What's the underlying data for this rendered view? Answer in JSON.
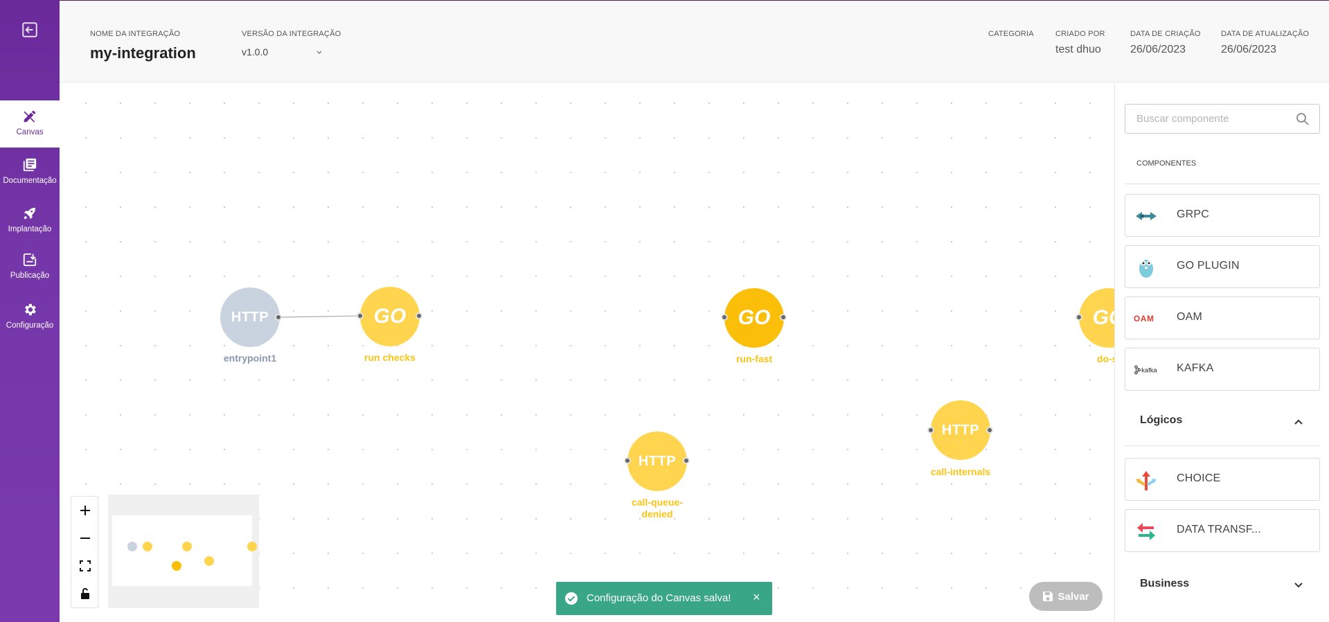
{
  "sidebar": {
    "items": [
      {
        "label": "Canvas",
        "icon": "pencil-ruler-icon"
      },
      {
        "label": "Documentação",
        "icon": "book-icon"
      },
      {
        "label": "Implantação",
        "icon": "rocket-icon"
      },
      {
        "label": "Publicação",
        "icon": "download-icon"
      },
      {
        "label": "Configuração",
        "icon": "gear-icon"
      }
    ]
  },
  "header": {
    "name_label": "NOME DA INTEGRAÇÃO",
    "name_value": "my-integration",
    "version_label": "VERSÃO DA INTEGRAÇÃO",
    "version_value": "v1.0.0",
    "category_label": "CATEGORIA",
    "created_by_label": "CRIADO POR",
    "created_by_value": "test dhuo",
    "created_date_label": "DATA DE CRIAÇÃO",
    "created_date_value": "26/06/2023",
    "updated_date_label": "DATA DE ATUALIZAÇÃO",
    "updated_date_value": "26/06/2023"
  },
  "canvas": {
    "nodes": [
      {
        "id": "entrypoint1",
        "label": "entrypoint1",
        "text": "HTTP",
        "kind": "http-entry"
      },
      {
        "id": "run-checks",
        "label": "run checks",
        "text": "GO",
        "kind": "go"
      },
      {
        "id": "run-fast",
        "label": "run-fast",
        "text": "GO",
        "kind": "go-selected"
      },
      {
        "id": "do-st",
        "label": "do-st",
        "text": "GO",
        "kind": "go"
      },
      {
        "id": "call-queue-denied",
        "label_line1": "call-queue-",
        "label_line2": "denied",
        "text": "HTTP",
        "kind": "http"
      },
      {
        "id": "call-internals",
        "label": "call-internals",
        "text": "HTTP",
        "kind": "http"
      }
    ],
    "toast": "Configuração do Canvas salva!",
    "toast_close": "×",
    "save_label": "Salvar",
    "colors": {
      "accent": "#ffd54f",
      "accent_dark": "#fbbf0a",
      "entry": "#c9d3df",
      "toast": "#3aa688",
      "sidebar": "#6a2a9a"
    }
  },
  "panel": {
    "search_placeholder": "Buscar componente",
    "components_heading": "COMPONENTES",
    "components": [
      {
        "label": "GRPC",
        "icon": "grpc-icon"
      },
      {
        "label": "GO PLUGIN",
        "icon": "gopher-icon"
      },
      {
        "label": "OAM",
        "icon": "oam-logo-icon"
      },
      {
        "label": "KAFKA",
        "icon": "kafka-logo-icon"
      }
    ],
    "logicos_title": "Lógicos",
    "logicos": [
      {
        "label": "CHOICE",
        "icon": "split-arrows-icon"
      },
      {
        "label": "DATA TRANSF...",
        "icon": "swap-arrows-icon"
      }
    ],
    "business_title": "Business"
  }
}
